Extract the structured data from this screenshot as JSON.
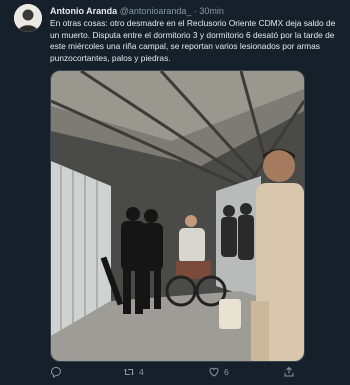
{
  "tweet": {
    "author_name": "Antonio Aranda",
    "handle": "@antonioaranda_",
    "separator": "·",
    "time": "30min",
    "text": "En otras cosas: otro desmadre en el Reclusorio Oriente CDMX deja saldo de un muerto. Disputa entre el dormitorio 3 y dormitorio 6 desató por la tarde de este miércoles una riña campal, se reportan varios lesionados por armas punzocortantes, palos y piedras.",
    "media_icon": "photo"
  },
  "actions": {
    "reply_icon": "reply-icon",
    "retweet_icon": "retweet-icon",
    "retweet_count": "4",
    "like_icon": "heart-icon",
    "like_count": "6",
    "share_icon": "share-icon"
  },
  "colors": {
    "background": "#15202b",
    "text": "#e7e9ea",
    "secondary": "#8b98a5"
  }
}
